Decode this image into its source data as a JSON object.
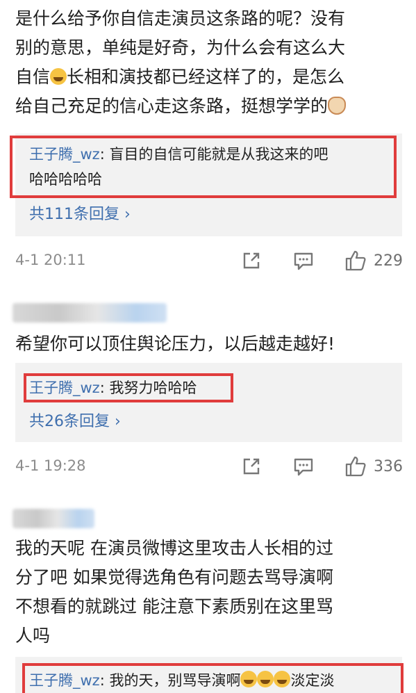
{
  "comment1": {
    "lines": [
      "是什么给予你自信走演员这条路的呢？没有",
      "别的意思，单纯是好奇，为什么会有这么大",
      "自信",
      "长相和演技都已经这样了的，是怎么",
      "给自己充足的信心走这条路，挺想学学的"
    ],
    "reply_user": "王子腾_wz",
    "reply_text_1": ": 盲目的自信可能就是从我这来的吧",
    "reply_text_2": "哈哈哈哈哈",
    "more_replies": "共111条回复 ›",
    "timestamp": "4-1 20:11",
    "likes": "229"
  },
  "comment2": {
    "text": "希望你可以顶住舆论压力，以后越走越好!",
    "reply_user": "王子腾_wz",
    "reply_text": ": 我努力哈哈哈",
    "more_replies": "共26条回复 ›",
    "timestamp": "4-1 19:28",
    "likes": "336"
  },
  "comment3": {
    "lines": [
      "我的天呢 在演员微博这里攻击人长相的过",
      "分了吧 如果觉得选角色有问题去骂导演啊",
      "不想看的就跳过 能注意下素质别在这里骂",
      "人吗"
    ],
    "reply_user": "王子腾_wz",
    "reply_text_a": ": 我的天，别骂导演啊",
    "reply_text_b": "淡定淡"
  },
  "colors": {
    "link": "#3f6fae",
    "highlight": "#e03c3c",
    "reply_bg": "#f2f2f2",
    "meta": "#8c8c8c"
  },
  "icons": [
    "share-icon",
    "comment-icon",
    "like-icon",
    "laugh-emoji-icon",
    "cat-emoji-icon"
  ]
}
